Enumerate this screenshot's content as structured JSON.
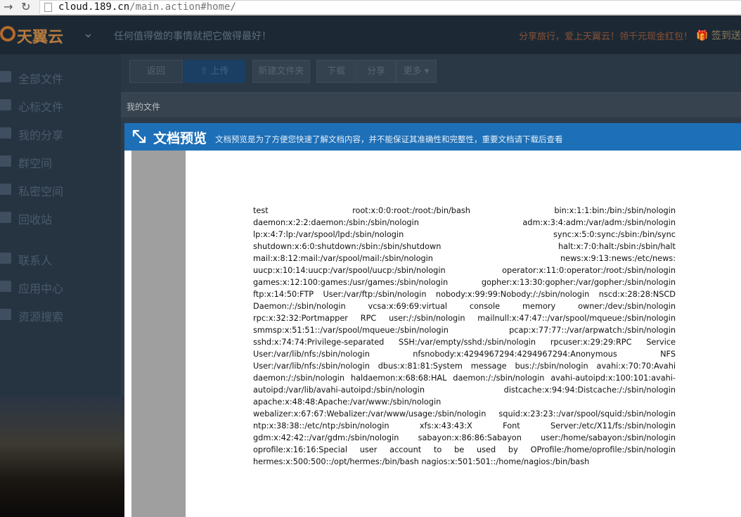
{
  "browser": {
    "url_domain": "cloud.189.cn",
    "url_path": "/main.action#home/"
  },
  "app": {
    "logo": "天翼云",
    "slogan": "任何值得做的事情就把它做得最好！",
    "promo": "分享旅行，爱上天翼云！领千元现金红包！",
    "signin": "签到送空",
    "sidebar": [
      {
        "label": "全部文件"
      },
      {
        "label": "心标文件"
      },
      {
        "label": "我的分享"
      },
      {
        "label": "群空间"
      },
      {
        "label": "私密空间"
      },
      {
        "label": "回收站"
      },
      {
        "label": "联系人"
      },
      {
        "label": "应用中心"
      },
      {
        "label": "资源搜索"
      }
    ],
    "toolbar": {
      "back": "返回",
      "upload": "上传",
      "new_folder": "新建文件夹",
      "download": "下载",
      "share": "分享",
      "more": "更多"
    },
    "breadcrumb": "我的文件"
  },
  "preview": {
    "title": "文档预览",
    "notice": "文档预览是为了方便您快速了解文档内容，并不能保证其准确性和完整性，重要文档请下载后查看",
    "lines": [
      "test root:x:0:0:root:/root:/bin/bash bin:x:1:1:bin:/bin:/sbin/nologin",
      "daemon:x:2:2:daemon:/sbin:/sbin/nologin adm:x:3:4:adm:/var/adm:/sbin/nologin",
      "lp:x:4:7:lp:/var/spool/lpd:/sbin/nologin sync:x:5:0:sync:/sbin:/bin/sync",
      "shutdown:x:6:0:shutdown:/sbin:/sbin/shutdown halt:x:7:0:halt:/sbin:/sbin/halt",
      "mail:x:8:12:mail:/var/spool/mail:/sbin/nologin news:x:9:13:news:/etc/news:",
      "uucp:x:10:14:uucp:/var/spool/uucp:/sbin/nologin operator:x:11:0:operator:/root:/sbin/nologin",
      "games:x:12:100:games:/usr/games:/sbin/nologin gopher:x:13:30:gopher:/var/gopher:/sbin/nologin",
      "ftp:x:14:50:FTP User:/var/ftp:/sbin/nologin nobody:x:99:99:Nobody:/:/sbin/nologin nscd:x:28:28:NSCD",
      "Daemon:/:/sbin/nologin vcsa:x:69:69:virtual console memory owner:/dev:/sbin/nologin",
      "rpc:x:32:32:Portmapper RPC user:/:/sbin/nologin mailnull:x:47:47::/var/spool/mqueue:/sbin/nologin",
      "smmsp:x:51:51::/var/spool/mqueue:/sbin/nologin pcap:x:77:77::/var/arpwatch:/sbin/nologin",
      "sshd:x:74:74:Privilege-separated SSH:/var/empty/sshd:/sbin/nologin rpcuser:x:29:29:RPC Service",
      "User:/var/lib/nfs:/sbin/nologin nfsnobody:x:4294967294:4294967294:Anonymous NFS",
      "User:/var/lib/nfs:/sbin/nologin dbus:x:81:81:System message bus:/:/sbin/nologin avahi:x:70:70:Avahi",
      "daemon:/:/sbin/nologin haldaemon:x:68:68:HAL daemon:/:/sbin/nologin avahi-autoipd:x:100:101:avahi-",
      "autoipd:/var/lib/avahi-autoipd:/sbin/nologin distcache:x:94:94:Distcache:/:/sbin/nologin",
      "apache:x:48:48:Apache:/var/www:/sbin/nologin",
      "webalizer:x:67:67:Webalizer:/var/www/usage:/sbin/nologin squid:x:23:23::/var/spool/squid:/sbin/nologin",
      "ntp:x:38:38::/etc/ntp:/sbin/nologin xfs:x:43:43:X Font Server:/etc/X11/fs:/sbin/nologin",
      "gdm:x:42:42::/var/gdm:/sbin/nologin sabayon:x:86:86:Sabayon user:/home/sabayon:/sbin/nologin",
      "oprofile:x:16:16:Special user account to be used by OProfile:/home/oprofile:/sbin/nologin",
      "hermes:x:500:500::/opt/hermes:/bin/bash nagios:x:501:501::/home/nagios:/bin/bash"
    ]
  }
}
